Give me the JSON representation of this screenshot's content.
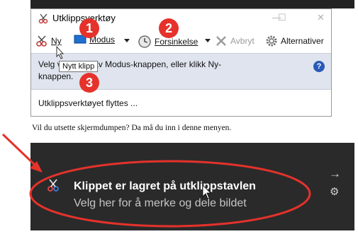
{
  "window": {
    "title": "Utklippsverktøy",
    "minimize": "—",
    "maximize": "☐",
    "close": "✕"
  },
  "toolbar": {
    "new_label": "Ny",
    "mode_label": "Modus",
    "delay_label": "Forsinkelse",
    "cancel_label": "Avbryt",
    "options_label": "Alternativer"
  },
  "tooltip": "Nytt klipp",
  "message": {
    "line1": "Velg          ved hjelp av Modus-knappen, eller klikk Ny-",
    "line2": "knappen."
  },
  "status": "Utklippsverktøyet flyttes ...",
  "caption": "Vil du utsette skjermdumpen? Da må du inn i denne menyen.",
  "badges": [
    "1",
    "2",
    "3"
  ],
  "notification": {
    "title": "Klippet er lagret på utklippstavlen",
    "subtitle": "Velg her for å merke og dele bildet",
    "arrow": "→",
    "gear": "⚙"
  },
  "colors": {
    "annotation_red": "#e5322b",
    "notification_bg": "#2a2a2a",
    "message_bg": "#dfe4ee"
  }
}
